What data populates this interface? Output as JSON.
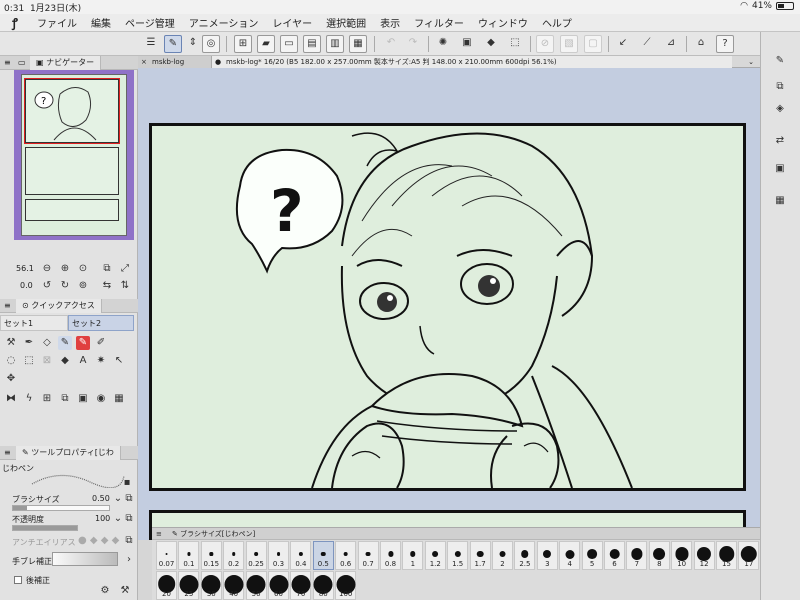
{
  "status": {
    "time": "0:31",
    "date": "1月23日(木)",
    "wifi": "wifi-icon",
    "battery": "41%"
  },
  "menu": {
    "items": [
      "ファイル",
      "編集",
      "ページ管理",
      "アニメーション",
      "レイヤー",
      "選択範囲",
      "表示",
      "フィルター",
      "ウィンドウ",
      "ヘルプ"
    ]
  },
  "navigator": {
    "title": "ナビゲーター",
    "zoom": "56.1",
    "rotation": "0.0",
    "bubble": "?"
  },
  "quick_access": {
    "title": "クイックアクセス",
    "set1": "セット1",
    "set2": "セット2"
  },
  "tool_property": {
    "title": "ツールプロパティ[じわ",
    "tool_name": "じわペン",
    "brush_size_label": "ブラシサイズ",
    "brush_size_value": "0.50",
    "opacity_label": "不透明度",
    "opacity_value": "100",
    "opacity_fraction": 1.0,
    "antialias_label": "アンチエイリアス",
    "stabilization_label": "手ブレ補正",
    "post_correction_label": "後補正"
  },
  "document": {
    "tab1": "mskb-log",
    "tab2": "mskb-log* 16/20 (B5 182.00 x 257.00mm 製本サイズ:A5 判 148.00 x 210.00mm 600dpi 56.1%)",
    "bubble_text": "?"
  },
  "brush_palette": {
    "title": "ブラシサイズ[じわペン]",
    "selected": "0.5",
    "row1": [
      "0.07",
      "0.1",
      "0.15",
      "0.2",
      "0.25",
      "0.3",
      "0.4",
      "0.5",
      "0.6",
      "0.7",
      "0.8",
      "1",
      "1.2",
      "1.5",
      "1.7",
      "2",
      "2.5",
      "3",
      "4",
      "5",
      "6",
      "7",
      "8",
      "10",
      "12",
      "15",
      "17"
    ],
    "row2": [
      "20",
      "25",
      "30",
      "40",
      "50",
      "60",
      "70",
      "80",
      "100"
    ]
  },
  "colors": {
    "navigator_bg": "#8f72c8",
    "canvas_bg": "#c3cde0",
    "page_bg": "#dfeedd",
    "selected": "#cbd5e5"
  }
}
